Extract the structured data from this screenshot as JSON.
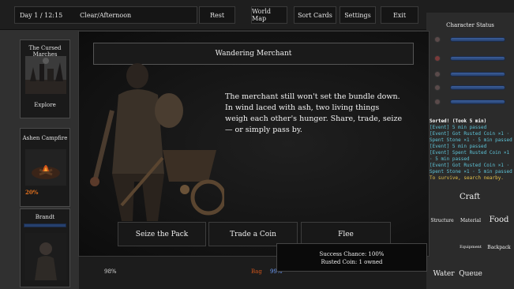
{
  "topbar": {
    "day_time": "Day 1 / 12:15",
    "weather": "Clear/Afternoon",
    "rest": "Rest",
    "world_map": "World Map",
    "sort_cards": "Sort Cards",
    "settings": "Settings",
    "exit": "Exit"
  },
  "left_cards": {
    "cursed_marches": {
      "title": "The Cursed Marches",
      "label": "Explore"
    },
    "campfire": {
      "title": "Ashen Campfire",
      "percent": "20%"
    },
    "character": {
      "title": "Brandt"
    }
  },
  "right_panel": {
    "status_title": "Character Status",
    "log": {
      "header": "Sorted! (Took 5 min)",
      "lines": [
        "[Event] 5 min passed",
        "[Event] Got Rusted Coin ×1 · Spent Stone ×1 · 5 min passed",
        "[Event] 5 min passed",
        "[Event] Spent Rusted Coin ×1 · 5 min passed",
        "[Event] Got Rusted Coin ×1 · Spent Stone ×1 · 5 min passed"
      ],
      "hint": "To survive, search nearby."
    },
    "craft": {
      "title": "Craft",
      "structure": "Structure",
      "material": "Material",
      "food": "Food",
      "equipment": "Equipment",
      "backpack": "Backpack",
      "water": "Water",
      "queue": "Queue"
    }
  },
  "bottombar": {
    "pct_left": "98%",
    "bag": "Bag",
    "pct_mid": "99%"
  },
  "modal": {
    "title": "Wandering Merchant",
    "text": "The merchant still won't set the bundle down. In wind laced with ash, two living things weigh each other's hunger. Share, trade, seize — or simply pass by.",
    "choices": {
      "seize": "Seize the Pack",
      "trade": "Trade a Coin",
      "flee": "Flee"
    },
    "tooltip": {
      "success": "Success Chance: 100%",
      "owned": "Rusted Coin: 1 owned"
    }
  },
  "colors": {
    "stat_bar": "#3d5f9a",
    "event_text": "#5ec4d8",
    "hint_text": "#e5c24a",
    "campfire_pct": "#e0701e"
  }
}
